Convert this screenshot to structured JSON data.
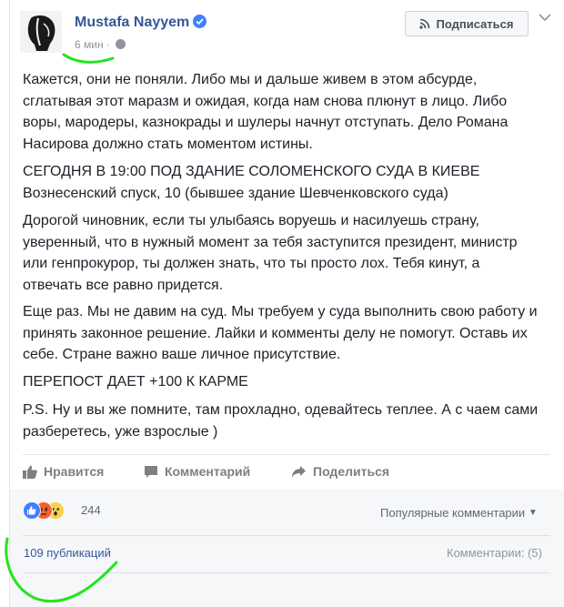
{
  "post": {
    "author": "Mustafa Nayyem",
    "time": "6 мин",
    "subscribe_label": "Подписаться",
    "paragraphs": [
      "Кажется, они не поняли. Либо мы и дальше живем в этом абсурде, сглатывая этот маразм и ожидая, когда нам снова плюнут в лицо. Либо воры, мародеры, казнокрады и шулеры начнут отступать. Дело Романа Насирова должно стать моментом истины.",
      "СЕГОДНЯ В 19:00 ПОД ЗДАНИЕ СОЛОМЕНСКОГО СУДА В КИЕВЕ Вознесенский спуск, 10 (бывшее здание Шевченковского суда)",
      "Дорогой чиновник, если ты улыбаясь воруешь и насилуешь страну, уверенный, что в нужный момент за тебя заступится президент, министр или генпрокурор, ты должен знать, что ты просто лох. Тебя кинут, а отвечать все равно придется.",
      "Еще раз. Мы не давим на суд. Мы требуем у суда выполнить свою работу и принять законное решение. Лайки и комменты делу не помогут. Оставь их себе. Стране важно ваше личное присутствие.",
      "ПЕРЕПОСТ ДАЕТ +100 К КАРМЕ",
      "P.S. Ну и вы же помните, там прохладно, одевайтесь теплее. А с чаем сами разберетесь, уже взрослые )"
    ]
  },
  "actions": {
    "like": "Нравится",
    "comment": "Комментарий",
    "share": "Поделиться"
  },
  "reactions": {
    "count": "244",
    "sort_label": "Популярные комментарии",
    "icons": [
      "like-icon",
      "angry-icon",
      "wow-icon"
    ]
  },
  "footer": {
    "shares": "109 публикаций",
    "comments": "Комментарии: (5)"
  },
  "colors": {
    "link": "#365899",
    "muted": "#90949c",
    "annotation": "#22e51f"
  }
}
